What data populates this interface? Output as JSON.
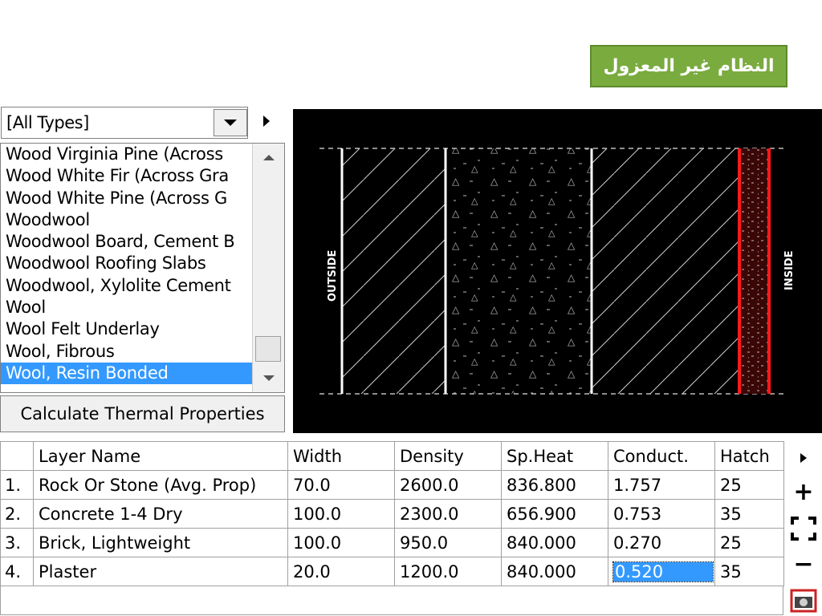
{
  "header": {
    "title_badge": "النظام غير المعزول"
  },
  "material_panel": {
    "type_filter": "[All Types]",
    "items": [
      "Wood Virginia Pine (Across",
      "Wood White Fir (Across Gra",
      "Wood White Pine (Across G",
      "Woodwool",
      "Woodwool Board, Cement B",
      "Woodwool Roofing Slabs",
      "Woodwool, Xylolite Cement",
      "Wool",
      "Wool Felt Underlay",
      "Wool, Fibrous",
      "Wool, Resin Bonded"
    ],
    "selected_item": "Wool, Resin Bonded",
    "calculate_button": "Calculate Thermal Properties"
  },
  "wall_view": {
    "outside_label": "OUTSIDE",
    "inside_label": "INSIDE",
    "colors": {
      "background": "#000000",
      "lines": "#ffffff",
      "highlight_layer": "#ff1a1a"
    }
  },
  "layer_table": {
    "headers": [
      "",
      "Layer Name",
      "Width",
      "Density",
      "Sp.Heat",
      "Conduct.",
      "Hatch"
    ],
    "rows": [
      {
        "idx": "1.",
        "name": "Rock Or Stone (Avg. Prop)",
        "width": "70.0",
        "density": "2600.0",
        "sp_heat": "836.800",
        "conduct": "1.757",
        "hatch": "25"
      },
      {
        "idx": "2.",
        "name": "Concrete 1-4 Dry",
        "width": "100.0",
        "density": "2300.0",
        "sp_heat": "656.900",
        "conduct": "0.753",
        "hatch": "35"
      },
      {
        "idx": "3.",
        "name": "Brick, Lightweight",
        "width": "100.0",
        "density": "950.0",
        "sp_heat": "840.000",
        "conduct": "0.270",
        "hatch": "25"
      },
      {
        "idx": "4.",
        "name": "Plaster",
        "width": "20.0",
        "density": "1200.0",
        "sp_heat": "840.000",
        "conduct": "0.520",
        "hatch": "35"
      }
    ]
  },
  "toolbar": {
    "add_label": "+",
    "remove_label": "−",
    "icons": [
      "expand-arrow-icon",
      "add-layer-icon",
      "fit-view-icon",
      "remove-layer-icon",
      "camera-icon"
    ]
  },
  "accent_colors": {
    "title_green": "#7aab3f",
    "selection_blue": "#3399ff"
  }
}
